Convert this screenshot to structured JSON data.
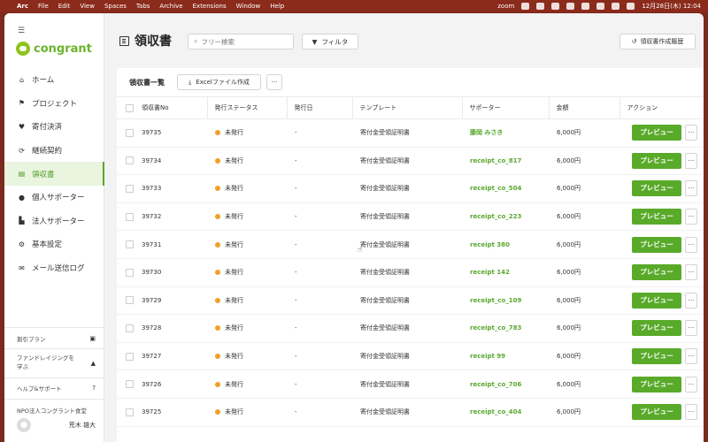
{
  "menubar": {
    "apple": "",
    "items": [
      "Arc",
      "File",
      "Edit",
      "View",
      "Spaces",
      "Tabs",
      "Archive",
      "Extensions",
      "Window",
      "Help"
    ],
    "zoom": "zoom",
    "datetime": "12月28日(木)  12:04"
  },
  "sidebar": {
    "logo_text": "congrant",
    "items": [
      {
        "label": "ホーム",
        "icon": "home-icon",
        "glyph": "⌂"
      },
      {
        "label": "プロジェクト",
        "icon": "flag-icon",
        "glyph": "⚑"
      },
      {
        "label": "寄付決済",
        "icon": "heart-icon",
        "glyph": "♥"
      },
      {
        "label": "継続契約",
        "icon": "refresh-icon",
        "glyph": "⟳"
      },
      {
        "label": "領収書",
        "icon": "receipt-icon",
        "glyph": "▤"
      },
      {
        "label": "個人サポーター",
        "icon": "person-icon",
        "glyph": "●"
      },
      {
        "label": "法人サポーター",
        "icon": "building-icon",
        "glyph": "▙"
      },
      {
        "label": "基本設定",
        "icon": "gear-icon",
        "glyph": "⚙"
      },
      {
        "label": "メール送信ログ",
        "icon": "mail-icon",
        "glyph": "✉"
      }
    ],
    "plan": "割引プラン",
    "fundraising": "ファンドレイジングを学ぶ",
    "help": "ヘルプ&サポート",
    "org_name": "NPO法人コングラント食堂",
    "user_name": "荒木 雄大"
  },
  "header": {
    "title": "領収書",
    "search_placeholder": "フリー検索",
    "filter_label": "フィルタ",
    "history_label": "領収書作成履歴"
  },
  "list": {
    "title": "領収書一覧",
    "excel_label": "Excelファイル作成",
    "more_label": "···",
    "columns": [
      "領収書No",
      "発行ステータス",
      "発行日",
      "テンプレート",
      "サポーター",
      "金額",
      "アクション"
    ],
    "preview_label": "プレビュー",
    "rows": [
      {
        "no": "39735",
        "status": "未発行",
        "date": "-",
        "template": "寄付金受領証明書",
        "supporter": "藤岡 みさき",
        "amount": "6,000円"
      },
      {
        "no": "39734",
        "status": "未発行",
        "date": "-",
        "template": "寄付金受領証明書",
        "supporter": "receipt_co_817",
        "amount": "6,000円"
      },
      {
        "no": "39733",
        "status": "未発行",
        "date": "-",
        "template": "寄付金受領証明書",
        "supporter": "receipt_co_504",
        "amount": "6,000円"
      },
      {
        "no": "39732",
        "status": "未発行",
        "date": "-",
        "template": "寄付金受領証明書",
        "supporter": "receipt_co_223",
        "amount": "6,000円"
      },
      {
        "no": "39731",
        "status": "未発行",
        "date": "-",
        "template": "寄付金受領証明書",
        "supporter": "receipt 380",
        "amount": "6,000円"
      },
      {
        "no": "39730",
        "status": "未発行",
        "date": "-",
        "template": "寄付金受領証明書",
        "supporter": "receipt 142",
        "amount": "6,000円"
      },
      {
        "no": "39729",
        "status": "未発行",
        "date": "-",
        "template": "寄付金受領証明書",
        "supporter": "receipt_co_109",
        "amount": "6,000円"
      },
      {
        "no": "39728",
        "status": "未発行",
        "date": "-",
        "template": "寄付金受領証明書",
        "supporter": "receipt_co_783",
        "amount": "6,000円"
      },
      {
        "no": "39727",
        "status": "未発行",
        "date": "-",
        "template": "寄付金受領証明書",
        "supporter": "receipt 99",
        "amount": "6,000円"
      },
      {
        "no": "39726",
        "status": "未発行",
        "date": "-",
        "template": "寄付金受領証明書",
        "supporter": "receipt_co_706",
        "amount": "6,000円"
      },
      {
        "no": "39725",
        "status": "未発行",
        "date": "-",
        "template": "寄付金受領証明書",
        "supporter": "receipt_co_404",
        "amount": "6,000円"
      }
    ]
  },
  "colors": {
    "accent": "#5aaa2a",
    "status_dot": "#f0a028",
    "menubar": "#8b2b1c"
  }
}
